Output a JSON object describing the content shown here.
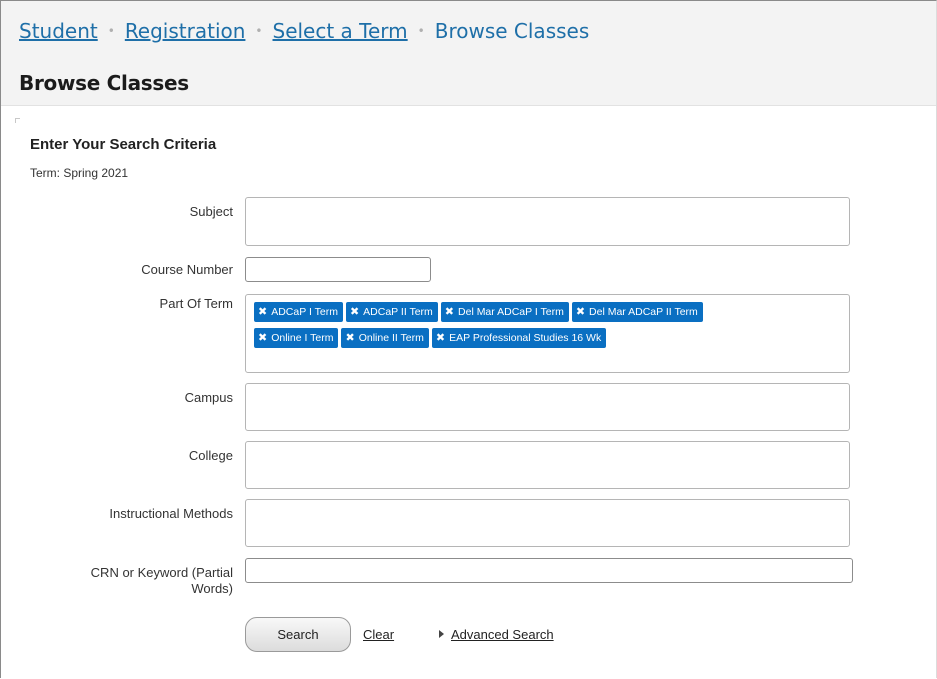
{
  "breadcrumb": {
    "items": [
      {
        "label": "Student",
        "link": true
      },
      {
        "label": "Registration",
        "link": true
      },
      {
        "label": "Select a Term",
        "link": true
      },
      {
        "label": "Browse Classes",
        "link": false
      }
    ],
    "separator": "•"
  },
  "page_title": "Browse Classes",
  "form": {
    "section_title": "Enter Your Search Criteria",
    "term_line": "Term: Spring 2021",
    "fields": {
      "subject": {
        "label": "Subject",
        "value": ""
      },
      "course_number": {
        "label": "Course Number",
        "value": ""
      },
      "part_of_term": {
        "label": "Part Of Term",
        "selected": [
          "ADCaP I Term",
          "ADCaP II Term",
          "Del Mar ADCaP I Term",
          "Del Mar ADCaP II Term",
          "Online I Term",
          "Online II Term",
          "EAP Professional Studies 16 Wk"
        ]
      },
      "campus": {
        "label": "Campus",
        "value": ""
      },
      "college": {
        "label": "College",
        "value": ""
      },
      "instructional_methods": {
        "label": "Instructional Methods",
        "value": ""
      },
      "crn_keyword": {
        "label_line1": "CRN or Keyword (Partial",
        "label_line2": "Words)",
        "value": ""
      }
    },
    "buttons": {
      "search": "Search",
      "clear": "Clear",
      "advanced": "Advanced Search"
    },
    "chip_remove_icon": "close-icon",
    "colors": {
      "chip": "#0a6fc2",
      "link": "#1e6fa8",
      "header_bg": "#f3f3f3"
    }
  }
}
